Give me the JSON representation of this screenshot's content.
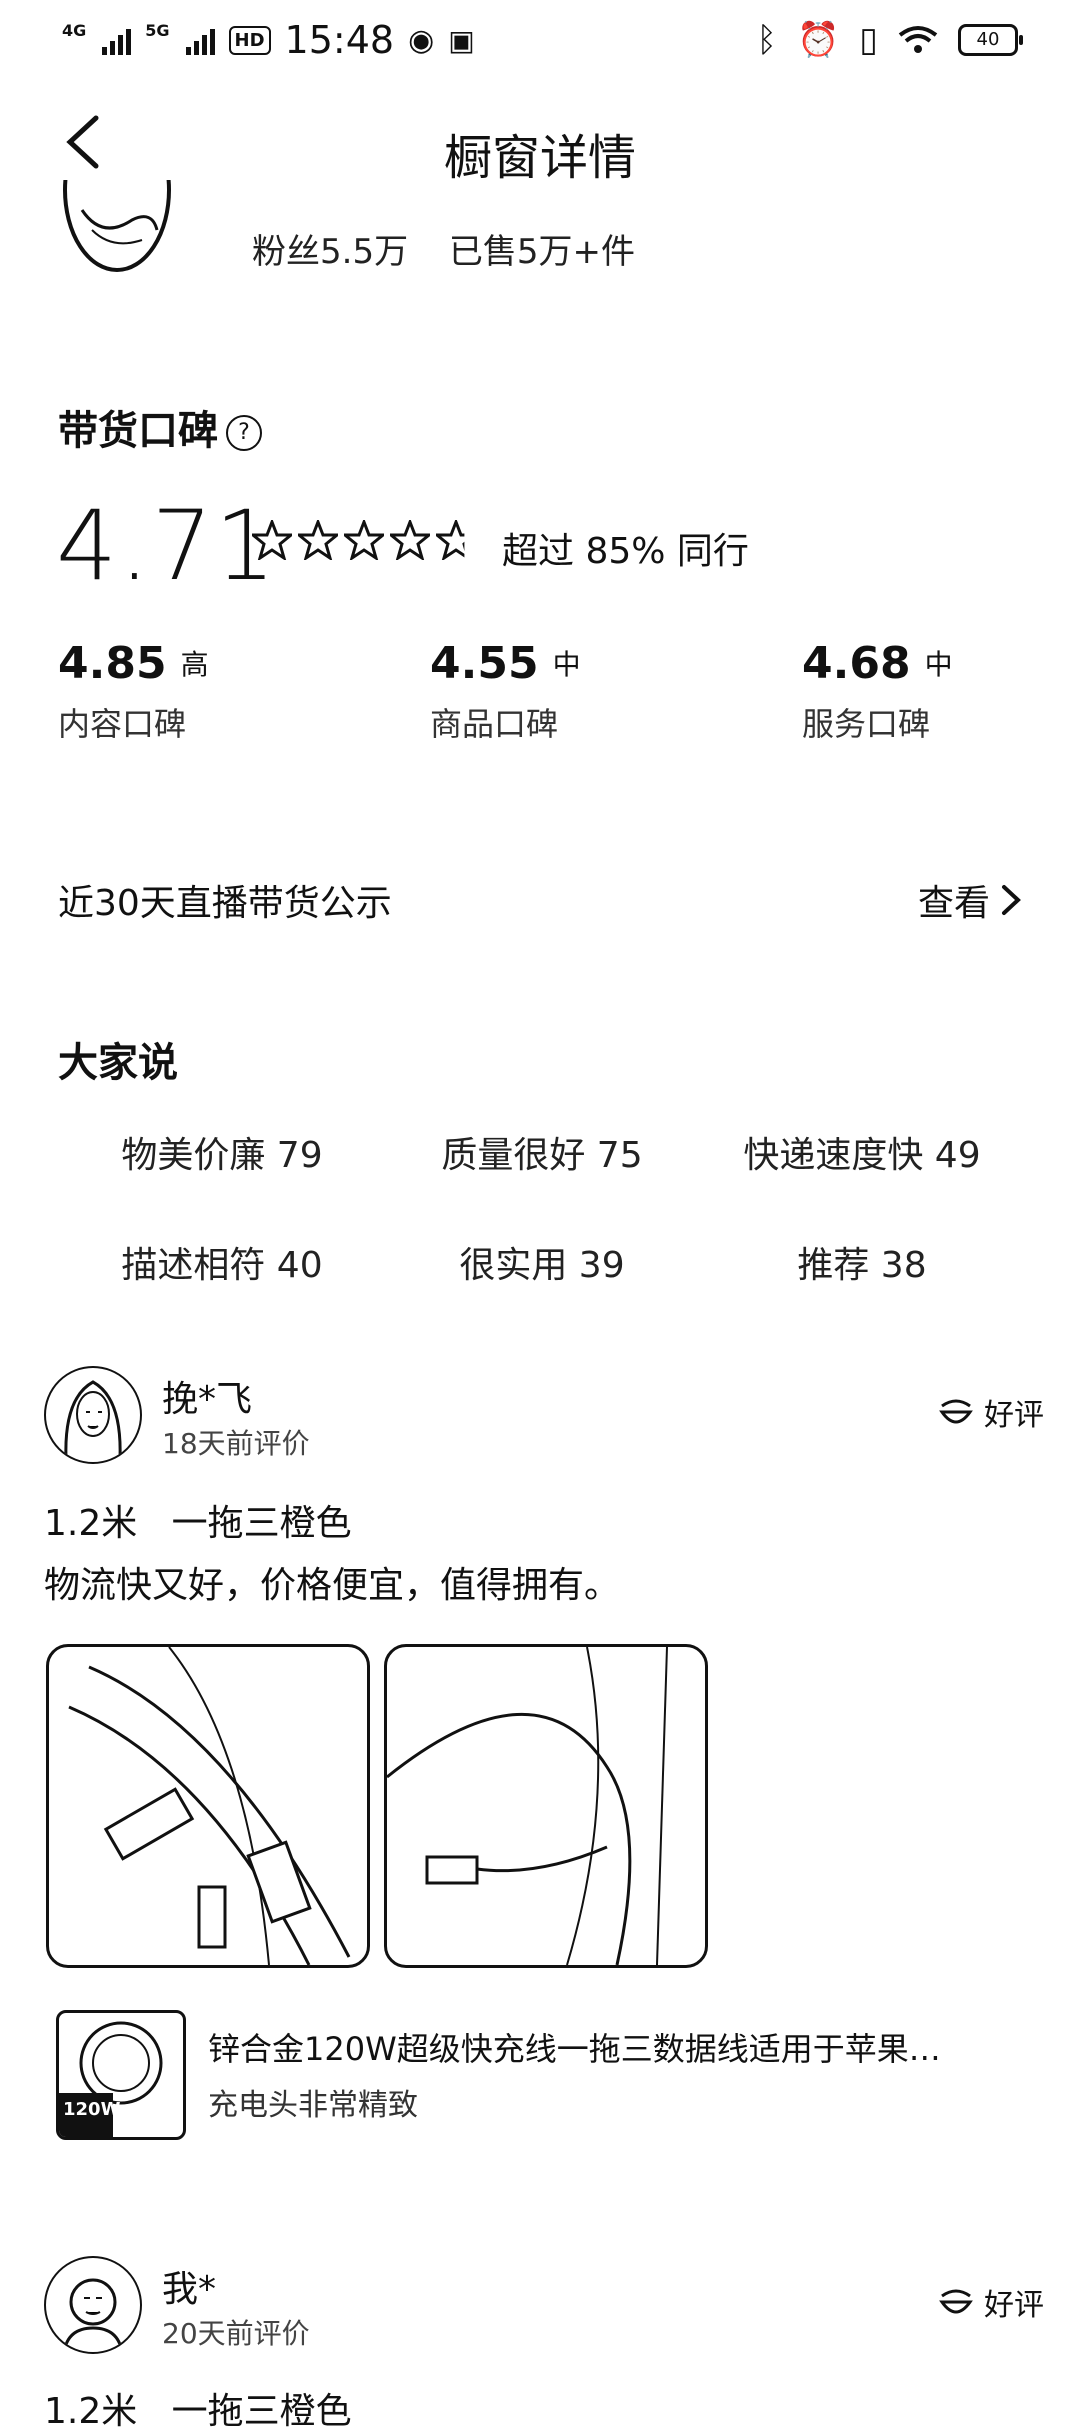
{
  "status": {
    "time": "15:48",
    "net1": "4G",
    "net2": "5G",
    "hd": "HD",
    "battery": "40"
  },
  "header": {
    "title": "橱窗详情"
  },
  "shop": {
    "fans": "粉丝5.5万",
    "sold": "已售5万+件"
  },
  "reputation": {
    "title": "带货口碑",
    "help_icon": "?",
    "score": "4.71",
    "stars": 4.71,
    "beat_text": "超过 85% 同行",
    "subs": [
      {
        "value": "4.85",
        "level": "高",
        "label": "内容口碑"
      },
      {
        "value": "4.55",
        "level": "中",
        "label": "商品口碑"
      },
      {
        "value": "4.68",
        "level": "中",
        "label": "服务口碑"
      }
    ]
  },
  "live": {
    "label": "近30天直播带货公示",
    "view": "查看"
  },
  "everyone": {
    "title": "大家说",
    "tags": [
      "物美价廉 79",
      "质量很好 75",
      "快递速度快 49",
      "描述相符 40",
      "很实用 39",
      "推荐 38"
    ]
  },
  "reviews": [
    {
      "name": "挽*飞",
      "time": "18天前评价",
      "badge": "好评",
      "spec": "1.2米   一拖三橙色",
      "text": "物流快又好，价格便宜，值得拥有。",
      "product_title": "锌合金120W超级快充线一拖三数据线适用于苹果…",
      "product_sub": "充电头非常精致",
      "thumb_label": "120W"
    },
    {
      "name": "我*",
      "time": "20天前评价",
      "badge": "好评",
      "spec": "1.2米   一拖三橙色"
    }
  ]
}
